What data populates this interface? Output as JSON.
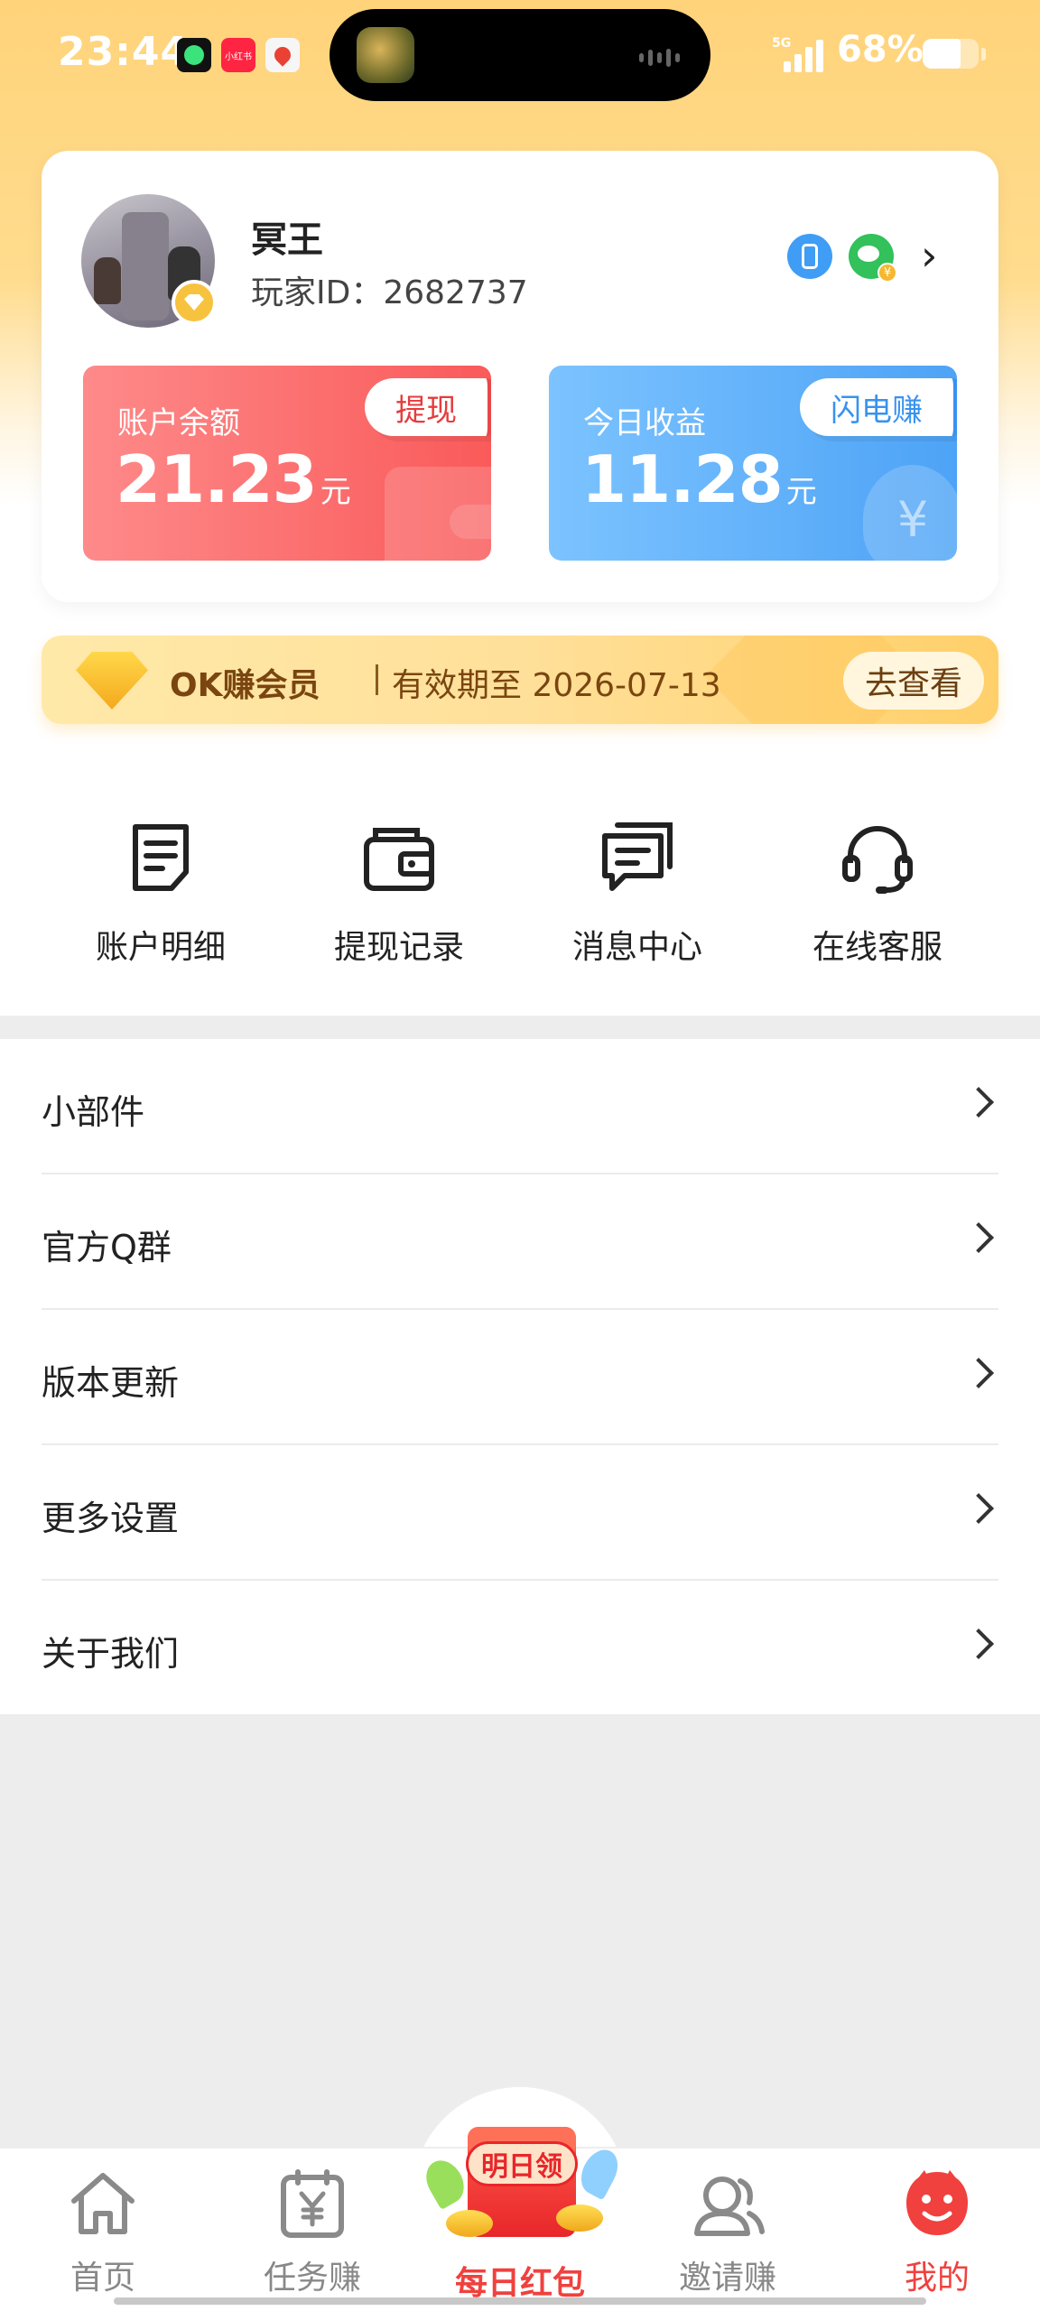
{
  "status_bar": {
    "time": "23:44",
    "app_badge_xhs": "小红书",
    "network": "5G",
    "battery": "68%",
    "battery_level": 0.68
  },
  "profile": {
    "name": "冥王",
    "player_id": "玩家ID：2682737"
  },
  "balance": {
    "label": "账户余额",
    "value": "21.23",
    "unit": "元",
    "button": "提现"
  },
  "today": {
    "label": "今日收益",
    "value": "11.28",
    "unit": "元",
    "button": "闪电赚"
  },
  "vip": {
    "title": "OK赚会员",
    "expiry": "有效期至 2026-07-13",
    "button": "去查看"
  },
  "quick_actions": [
    {
      "label": "账户明细",
      "icon": "document-icon"
    },
    {
      "label": "提现记录",
      "icon": "wallet-icon"
    },
    {
      "label": "消息中心",
      "icon": "message-icon"
    },
    {
      "label": "在线客服",
      "icon": "headset-icon"
    }
  ],
  "menu": [
    {
      "label": "小部件"
    },
    {
      "label": "官方Q群"
    },
    {
      "label": "版本更新"
    },
    {
      "label": "更多设置"
    },
    {
      "label": "关于我们"
    }
  ],
  "nav": {
    "home": "首页",
    "tasks": "任务赚",
    "daily": "每日红包",
    "daily_badge": "明日领",
    "invite": "邀请赚",
    "mine": "我的"
  },
  "colors": {
    "accent_red": "#F0413E",
    "accent_blue": "#4DA3F6",
    "vip_gold": "#F5A81C"
  }
}
